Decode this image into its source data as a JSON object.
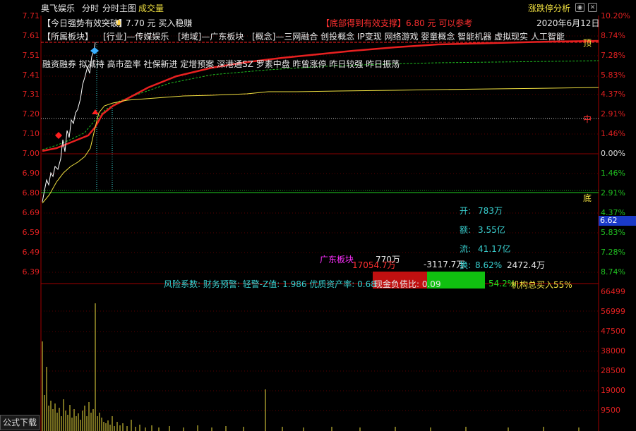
{
  "header": {
    "stock_name": "奥飞娱乐",
    "tab_fenshi": "分时",
    "tab_fenshi_main": "分时主图",
    "tab_volume": "成交量",
    "right_button": "涨跌停分析",
    "date_text": "2020年6月12日"
  },
  "annotations": {
    "strong_signal": "【今日强势有效突破】",
    "strong_price": "7.70 元 买入稳赚",
    "bottom_signal": "【底部得到有效支撑】",
    "bottom_price": "6.80 元 可以参考",
    "sector_line": "【所属板块】",
    "industry": "[行业]—传媒娱乐",
    "region": "[地域]—广东板块",
    "concepts": "[概念]—三网融合 创投概念 IP变现 网络游戏 婴童概念 智能机器 虚拟现实 人工智能",
    "tags_line": "融资融券 拟减持 高市盈率 社保新进 定增预案 深港通SZ 罗素中盘 昨曾涨停 昨日较强 昨日振荡",
    "label_top": "顶",
    "label_mid": "中",
    "label_bottom": "底"
  },
  "left_axis": [
    "7.71",
    "7.61",
    "7.51",
    "7.41",
    "7.31",
    "7.20",
    "7.10",
    "7.00",
    "6.90",
    "6.80",
    "6.69",
    "6.59",
    "6.49",
    "6.39"
  ],
  "right_axis": [
    "10.20%",
    "8.74%",
    "7.28%",
    "5.83%",
    "4.37%",
    "2.91%",
    "1.46%",
    "0.00%",
    "1.46%",
    "2.91%",
    "4.37%",
    "5.83%",
    "7.28%",
    "8.74%"
  ],
  "volume_axis": [
    "66499",
    "56999",
    "47500",
    "38000",
    "28500",
    "19000",
    "9500"
  ],
  "current_price_tag": "6.62",
  "stats": {
    "open_label": "开:",
    "open_value": "783万",
    "amount_label": "额:",
    "amount_value": "3.55亿",
    "float_label": "流:",
    "float_value": "41.17亿",
    "turnover_label": "换:",
    "turnover_value": "8.62%",
    "flow_a": "-3117.7万",
    "flow_b": "2472.4万",
    "sector_name": "广东板块",
    "sector_vol": "770万",
    "sector_flow": "17054.7万",
    "pct_54": "54.2%",
    "inst_buy": "机构总买入55%"
  },
  "risk_line": {
    "prefix": "风险系数: 财务预警: 轻警-Z值: 1.986 优质资产率: 0.68",
    "cash_debt": "现金负债比: 0.09"
  },
  "footer": {
    "formula_download": "公式下载"
  },
  "colors": {
    "axis_red": "#e02020",
    "price_line": "#ffffff",
    "avg_line": "#f0e040",
    "ma_red": "#e02020",
    "dashed_green": "#20c020",
    "bar_red": "#c01010",
    "bar_green": "#10c010"
  }
}
